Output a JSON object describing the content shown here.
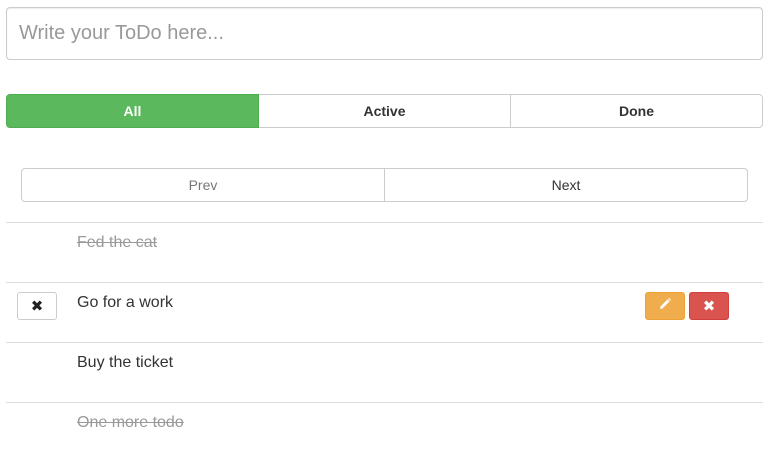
{
  "input": {
    "placeholder": "Write your ToDo here...",
    "value": ""
  },
  "filters": {
    "items": [
      {
        "label": "All",
        "active": true
      },
      {
        "label": "Active",
        "active": false
      },
      {
        "label": "Done",
        "active": false
      }
    ]
  },
  "pager": {
    "prev_label": "Prev",
    "next_label": "Next",
    "prev_disabled": true
  },
  "todos": [
    {
      "text": "Fed the cat",
      "done": true
    },
    {
      "text": "Go for a work",
      "done": false,
      "selected": true
    },
    {
      "text": "Buy the ticket",
      "done": false
    },
    {
      "text": "One more todo",
      "done": true
    }
  ],
  "icons": {
    "remove": "x-icon",
    "edit": "pencil-icon",
    "delete": "x-icon"
  },
  "colors": {
    "active_filter": "#5cb85c",
    "edit_button": "#f0ad4e",
    "delete_button": "#d9534f",
    "done_text": "#999999"
  }
}
